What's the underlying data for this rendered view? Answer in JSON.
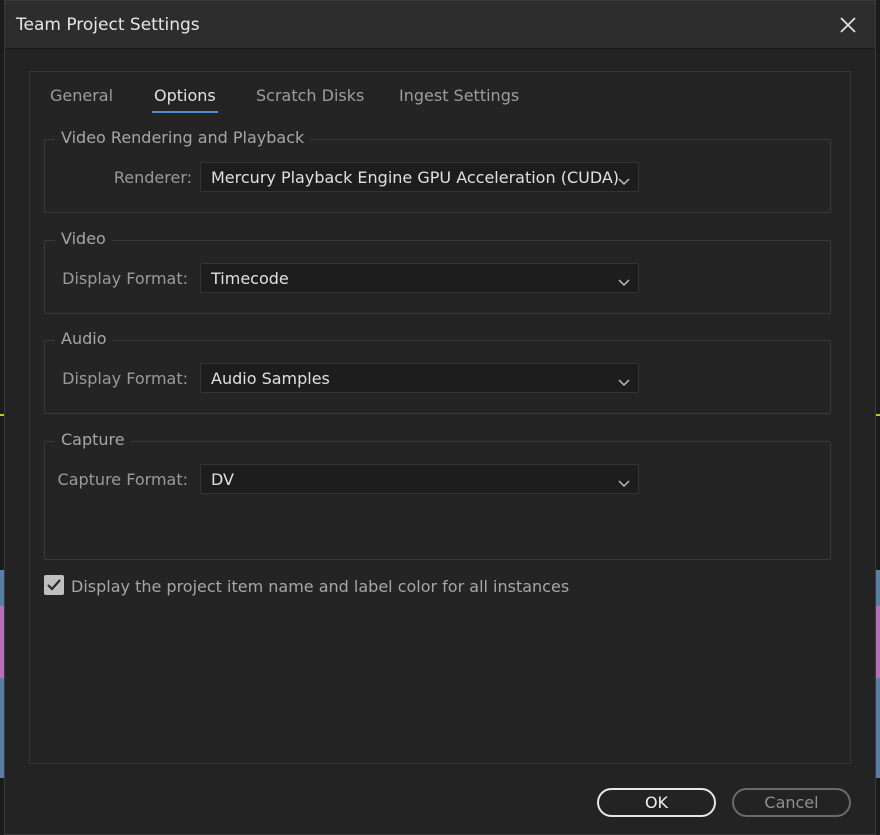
{
  "window": {
    "title": "Team Project Settings"
  },
  "tabs": [
    {
      "label": "General",
      "active": false
    },
    {
      "label": "Options",
      "active": true
    },
    {
      "label": "Scratch Disks",
      "active": false
    },
    {
      "label": "Ingest Settings",
      "active": false
    }
  ],
  "groups": {
    "video_rendering": {
      "legend": "Video Rendering and Playback",
      "renderer_label": "Renderer:",
      "renderer_value": "Mercury Playback Engine GPU Acceleration (CUDA)"
    },
    "video": {
      "legend": "Video",
      "display_format_label": "Display Format:",
      "display_format_value": "Timecode"
    },
    "audio": {
      "legend": "Audio",
      "display_format_label": "Display Format:",
      "display_format_value": "Audio Samples"
    },
    "capture": {
      "legend": "Capture",
      "capture_format_label": "Capture Format:",
      "capture_format_value": "DV"
    }
  },
  "display_item_name": {
    "label": "Display the project item name and label color for all instances",
    "checked": true
  },
  "buttons": {
    "ok": "OK",
    "cancel": "Cancel"
  },
  "colors": {
    "accent": "#4f8cd6",
    "dialog_bg": "#232323",
    "titlebar_bg": "#2d2d2d"
  }
}
